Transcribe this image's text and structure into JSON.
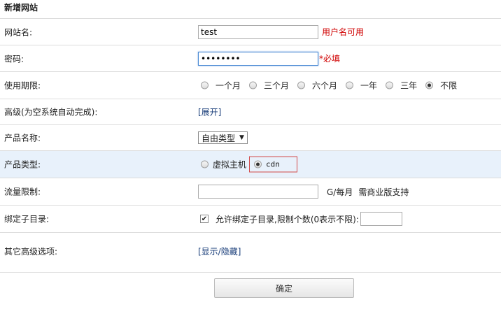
{
  "title": "新增网站",
  "site_name": {
    "label": "网站名:",
    "value": "test",
    "hint": "用户名可用"
  },
  "password": {
    "label": "密码:",
    "value": "••••••••",
    "hint": "*必填"
  },
  "period": {
    "label": "使用期限:",
    "options": [
      "一个月",
      "三个月",
      "六个月",
      "一年",
      "三年",
      "不限"
    ],
    "selected": 5
  },
  "advanced": {
    "label": "高级(为空系统自动完成):",
    "link": "[展开]"
  },
  "product_name": {
    "label": "产品名称:",
    "selected": "自由类型"
  },
  "product_type": {
    "label": "产品类型:",
    "options": [
      "虚拟主机",
      "cdn"
    ],
    "selected": 1
  },
  "traffic": {
    "label": "流量限制:",
    "value": "",
    "unit": "G/每月",
    "note": "需商业版支持"
  },
  "bind_subdir": {
    "label": "绑定子目录:",
    "text": "允许绑定子目录,限制个数(0表示不限):",
    "checked": true,
    "value": ""
  },
  "other": {
    "label": "其它高级选项:",
    "link": "[显示/隐藏]"
  },
  "submit": {
    "label": "确定"
  }
}
